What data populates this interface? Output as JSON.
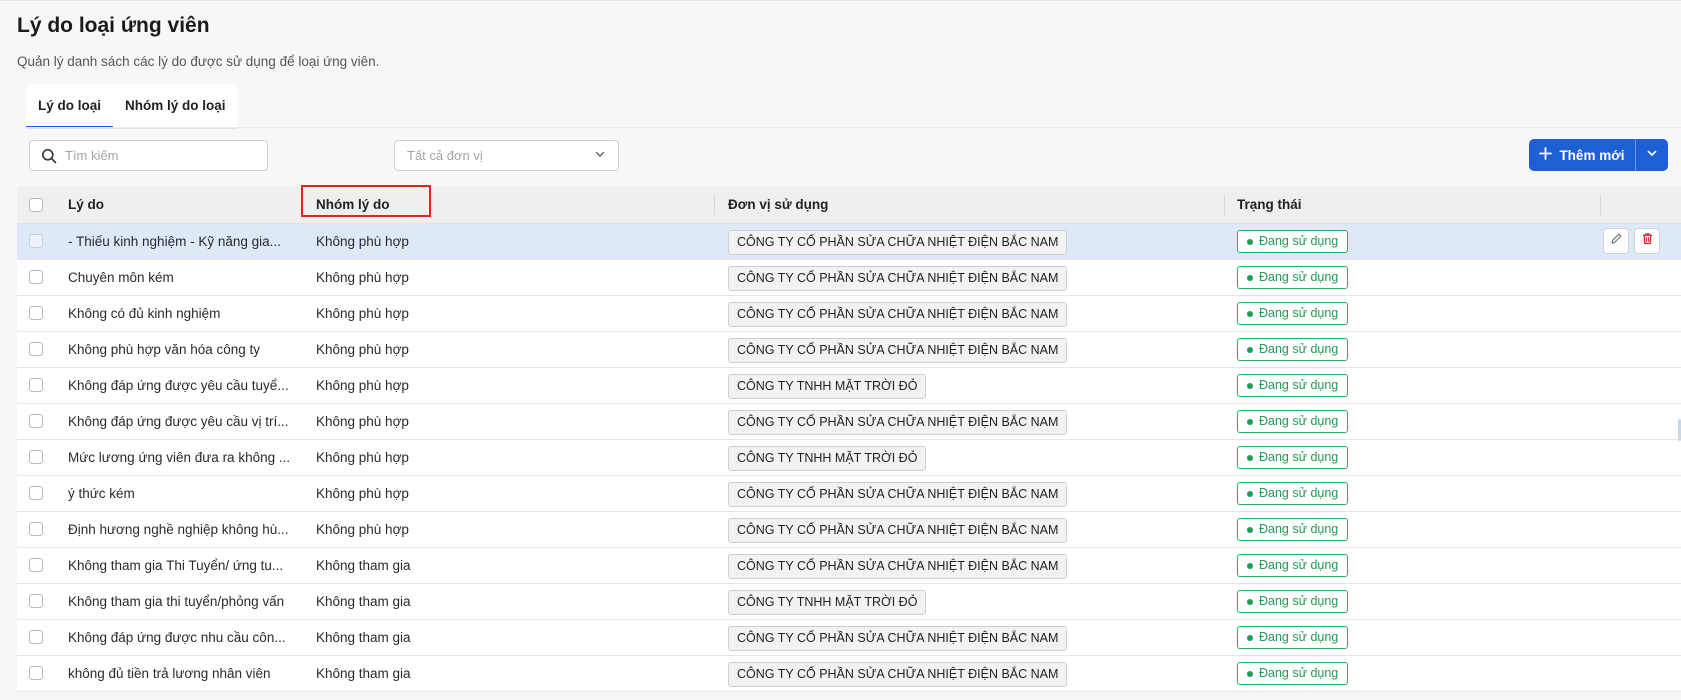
{
  "page": {
    "title": "Lý do loại ứng viên",
    "subtitle": "Quản lý danh sách các lý do được sử dụng để loại ứng viên."
  },
  "tabs": [
    {
      "label": "Lý do loại",
      "active": true
    },
    {
      "label": "Nhóm lý do loại",
      "active": false
    }
  ],
  "filters": {
    "search_placeholder": "Tìm kiếm",
    "unit_select_value": "Tất cả đơn vị"
  },
  "toolbar": {
    "add_label": "Thêm mới"
  },
  "table": {
    "columns": [
      "Lý do",
      "Nhóm lý do",
      "Đơn vị sử dụng",
      "Trạng thái"
    ],
    "rows": [
      {
        "reason": "- Thiếu kinh nghiệm - Kỹ năng gia...",
        "group": "Không phù hợp",
        "unit": "CÔNG TY CỔ PHẦN SỬA CHỮA NHIỆT ĐIỆN BẮC NAM",
        "status": "Đang sử dụng",
        "selected": true
      },
      {
        "reason": "Chuyên môn kém",
        "group": "Không phù hợp",
        "unit": "CÔNG TY CỔ PHẦN SỬA CHỮA NHIỆT ĐIỆN BẮC NAM",
        "status": "Đang sử dụng"
      },
      {
        "reason": "Không có đủ kinh nghiệm",
        "group": "Không phù hợp",
        "unit": "CÔNG TY CỔ PHẦN SỬA CHỮA NHIỆT ĐIỆN BẮC NAM",
        "status": "Đang sử dụng"
      },
      {
        "reason": "Không phù hợp văn hóa công ty",
        "group": "Không phù hợp",
        "unit": "CÔNG TY CỔ PHẦN SỬA CHỮA NHIỆT ĐIỆN BẮC NAM",
        "status": "Đang sử dụng"
      },
      {
        "reason": "Không đáp ứng được yêu cầu tuyể...",
        "group": "Không phù hợp",
        "unit": "CÔNG TY TNHH MẶT TRỜI ĐỎ",
        "status": "Đang sử dụng"
      },
      {
        "reason": "Không đáp ứng được yêu cầu vị trí...",
        "group": "Không phù hợp",
        "unit": "CÔNG TY CỔ PHẦN SỬA CHỮA NHIỆT ĐIỆN BẮC NAM",
        "status": "Đang sử dụng"
      },
      {
        "reason": "Mức lương ứng viên đưa ra không ...",
        "group": "Không phù hợp",
        "unit": "CÔNG TY TNHH MẶT TRỜI ĐỎ",
        "status": "Đang sử dụng"
      },
      {
        "reason": "ý thức kém",
        "group": "Không phù hợp",
        "unit": "CÔNG TY CỔ PHẦN SỬA CHỮA NHIỆT ĐIỆN BẮC NAM",
        "status": "Đang sử dụng"
      },
      {
        "reason": "Định hương nghề nghiệp không hù...",
        "group": "Không phù hợp",
        "unit": "CÔNG TY CỔ PHẦN SỬA CHỮA NHIỆT ĐIỆN BẮC NAM",
        "status": "Đang sử dụng"
      },
      {
        "reason": "Không tham gia Thi Tuyển/ ứng tu...",
        "group": "Không tham gia",
        "unit": "CÔNG TY CỔ PHẦN SỬA CHỮA NHIỆT ĐIỆN BẮC NAM",
        "status": "Đang sử dụng"
      },
      {
        "reason": "Không tham gia thi tuyển/phỏng vấn",
        "group": "Không tham gia",
        "unit": "CÔNG TY TNHH MẶT TRỜI ĐỎ",
        "status": "Đang sử dụng"
      },
      {
        "reason": "Không đáp ứng được nhu cầu côn...",
        "group": "Không tham gia",
        "unit": "CÔNG TY CỔ PHẦN SỬA CHỮA NHIỆT ĐIỆN BẮC NAM",
        "status": "Đang sử dụng"
      },
      {
        "reason": "không đủ tiền trả lương nhân viên",
        "group": "Không tham gia",
        "unit": "CÔNG TY CỔ PHẦN SỬA CHỮA NHIỆT ĐIỆN BẮC NAM",
        "status": "Đang sử dụng"
      }
    ]
  },
  "icons": {
    "search": "search-icon",
    "dropdown": "chevron-down-icon",
    "add": "plus-icon",
    "edit": "pencil-icon",
    "delete": "trash-icon"
  },
  "colors": {
    "primary": "#1f5fd6",
    "status_active": "#1f9d55",
    "selected_row": "#dde8f8",
    "highlight": "#e02424",
    "delete": "#e02424"
  }
}
